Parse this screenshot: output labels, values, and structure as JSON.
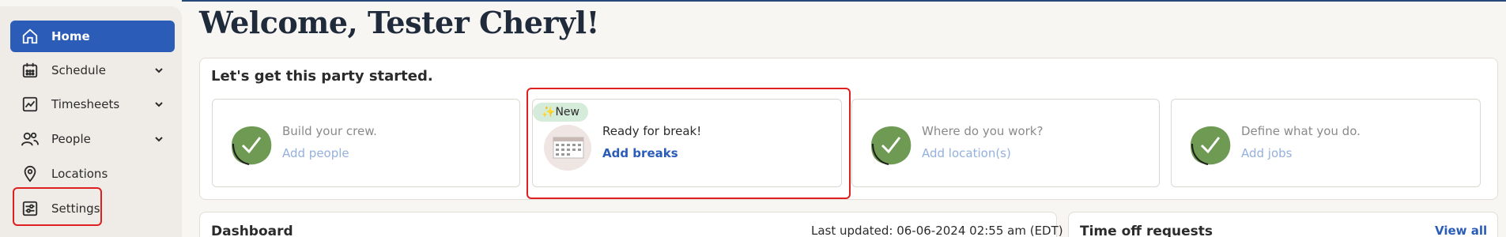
{
  "sidebar": {
    "items": [
      {
        "label": "Home",
        "icon": "home-icon",
        "active": true
      },
      {
        "label": "Schedule",
        "icon": "calendar-icon",
        "expandable": true
      },
      {
        "label": "Timesheets",
        "icon": "chart-icon",
        "expandable": true
      },
      {
        "label": "People",
        "icon": "people-icon",
        "expandable": true
      },
      {
        "label": "Locations",
        "icon": "location-pin-icon"
      },
      {
        "label": "Settings",
        "icon": "sliders-icon"
      }
    ]
  },
  "header": {
    "title": "Welcome, Tester Cheryl!"
  },
  "onboarding": {
    "title": "Let's get this party started.",
    "cards": [
      {
        "subtitle": "Build your crew.",
        "link": "Add people"
      },
      {
        "badge": "✨New",
        "subtitle": "Ready for break!",
        "link": "Add breaks"
      },
      {
        "subtitle": "Where do you work?",
        "link": "Add location(s)"
      },
      {
        "subtitle": "Define what you do.",
        "link": "Add jobs"
      }
    ]
  },
  "dashboard": {
    "title": "Dashboard",
    "updated": "Last updated: 06-06-2024 02:55 am (EDT)"
  },
  "time_off": {
    "title": "Time off requests",
    "view_all": "View all"
  },
  "colors": {
    "primary": "#2a5cb8",
    "highlight": "#e02020",
    "blob": "#6f9a54"
  }
}
